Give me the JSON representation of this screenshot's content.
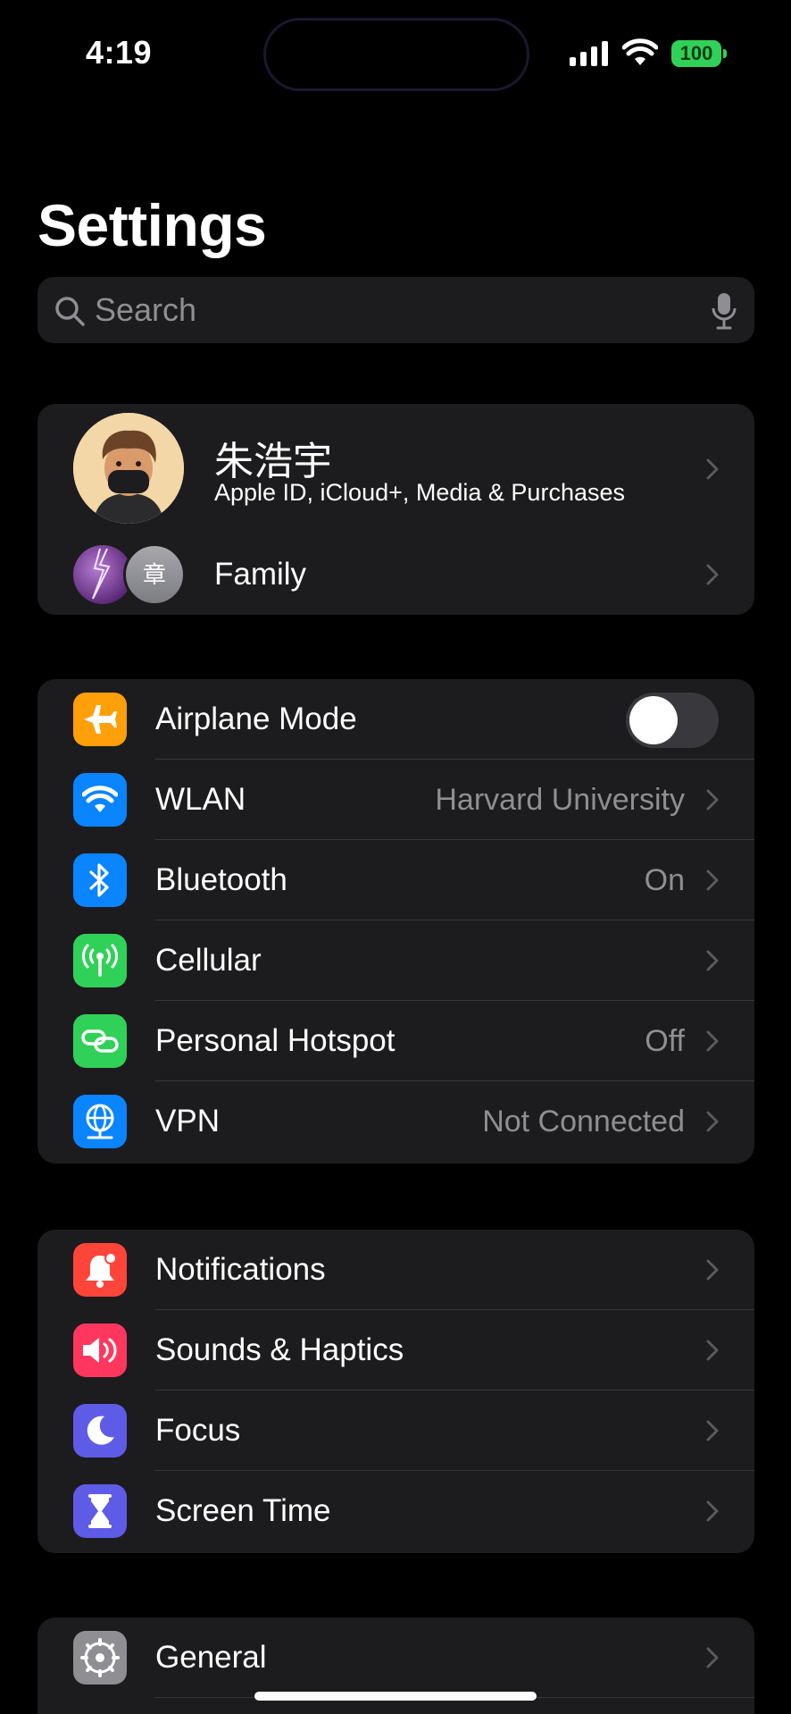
{
  "status_bar": {
    "time": "4:19",
    "battery": "100",
    "battery_color": "#30d158"
  },
  "header": {
    "title": "Settings"
  },
  "search": {
    "placeholder": "Search"
  },
  "profile": {
    "name": "朱浩宇",
    "subtitle": "Apple ID, iCloud+, Media & Purchases",
    "family_label": "Family",
    "family_avatar_initial": "章"
  },
  "connectivity": {
    "airplane_mode": {
      "label": "Airplane Mode",
      "on": false,
      "icon": "airplane-icon",
      "color": "#ff9f0a"
    },
    "wlan": {
      "label": "WLAN",
      "value": "Harvard University",
      "icon": "wifi-icon",
      "color": "#0a84ff"
    },
    "bluetooth": {
      "label": "Bluetooth",
      "value": "On",
      "icon": "bluetooth-icon",
      "color": "#0a84ff"
    },
    "cellular": {
      "label": "Cellular",
      "icon": "cellular-antenna-icon",
      "color": "#30d158"
    },
    "hotspot": {
      "label": "Personal Hotspot",
      "value": "Off",
      "icon": "hotspot-link-icon",
      "color": "#30d158"
    },
    "vpn": {
      "label": "VPN",
      "value": "Not Connected",
      "icon": "globe-network-icon",
      "color": "#0a84ff"
    }
  },
  "notifications_group": {
    "notifications": {
      "label": "Notifications",
      "icon": "bell-icon",
      "color": "#ff453a"
    },
    "sounds": {
      "label": "Sounds & Haptics",
      "icon": "speaker-icon",
      "color": "#ff375f"
    },
    "focus": {
      "label": "Focus",
      "icon": "moon-icon",
      "color": "#5e5ce6"
    },
    "screen_time": {
      "label": "Screen Time",
      "icon": "hourglass-icon",
      "color": "#5e5ce6"
    }
  },
  "general_group": {
    "general": {
      "label": "General",
      "icon": "gear-icon",
      "color": "#8e8e93"
    }
  }
}
